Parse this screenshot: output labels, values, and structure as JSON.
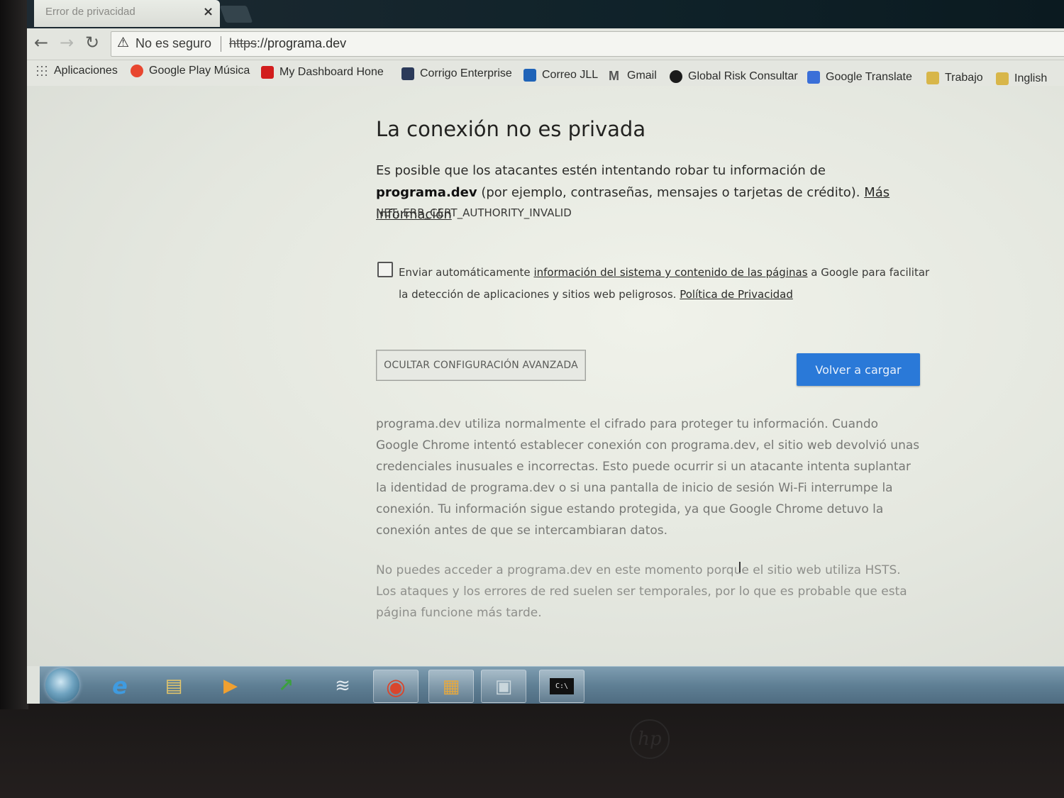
{
  "browser": {
    "tab_title": "Error de privacidad",
    "tab_close": "×",
    "security_label": "No es seguro",
    "url_scheme": "https",
    "url_rest": "://programa.dev"
  },
  "bookmarks": [
    {
      "label": "Aplicaciones",
      "icon": "apps-grid-icon",
      "color": "#6b6b6b"
    },
    {
      "label": "Google Play Música",
      "icon": "play-music-icon",
      "color": "#e8462f"
    },
    {
      "label": "My Dashboard Hone",
      "icon": "honeywell-icon",
      "color": "#d21d1d"
    },
    {
      "label": "Corrigo Enterprise",
      "icon": "corrigo-icon",
      "color": "#2b3a5a"
    },
    {
      "label": "Correo JLL",
      "icon": "outlook-icon",
      "color": "#1f63b8"
    },
    {
      "label": "Gmail",
      "icon": "gmail-icon",
      "color": "#555555"
    },
    {
      "label": "Global Risk Consultar",
      "icon": "global-risk-icon",
      "color": "#1b1b1b"
    },
    {
      "label": "Google Translate",
      "icon": "translate-icon",
      "color": "#3a6fd8"
    },
    {
      "label": "Trabajo",
      "icon": "folder-icon",
      "color": "#d8b64a"
    },
    {
      "label": "Inglish",
      "icon": "folder-icon",
      "color": "#d8b64a"
    }
  ],
  "page": {
    "heading": "La conexión no es privada",
    "intro_before": "Es posible que los atacantes estén intentando robar tu información de ",
    "intro_domain": "programa.dev",
    "intro_after": " (por ejemplo, contraseñas, mensajes o tarjetas de crédito). ",
    "more_info_link": "Más información",
    "error_code": "NET::ERR_CERT_AUTHORITY_INVALID",
    "checkbox_before": "Enviar automáticamente ",
    "checkbox_link": "información del sistema y contenido de las páginas",
    "checkbox_after": " a Google para facilitar la detección de aplicaciones y sitios web peligrosos. ",
    "privacy_link": "Política de Privacidad",
    "advanced_button": "OCULTAR CONFIGURACIÓN AVANZADA",
    "reload_button": "Volver a cargar",
    "details_paragraph": "programa.dev utiliza normalmente el cifrado para proteger tu información. Cuando Google Chrome intentó establecer conexión con programa.dev, el sitio web devolvió unas credenciales inusuales e incorrectas. Esto puede ocurrir si un atacante intenta suplantar la identidad de programa.dev o si una pantalla de inicio de sesión Wi-Fi interrumpe la conexión. Tu información sigue estando protegida, ya que Google Chrome detuvo la conexión antes de que se intercambiaran datos.",
    "hsts_paragraph": "No puedes acceder a programa.dev en este momento porque el sitio web utiliza HSTS. Los ataques y los errores de red suelen ser temporales, por lo que es probable que esta página funcione más tarde."
  },
  "taskbar": {
    "items": [
      {
        "icon": "internet-explorer-icon",
        "glyph": "e",
        "color": "#3f9be0"
      },
      {
        "icon": "file-explorer-icon",
        "glyph": "▤",
        "color": "#e6c76a"
      },
      {
        "icon": "media-player-icon",
        "glyph": "▶",
        "color": "#f0a030"
      },
      {
        "icon": "stock-chart-icon",
        "glyph": "↗",
        "color": "#3ca040"
      },
      {
        "icon": "wireless-icon",
        "glyph": "≋",
        "color": "#e0e8ee"
      },
      {
        "icon": "chrome-icon",
        "glyph": "◉",
        "color": "#d9462d"
      },
      {
        "icon": "app-tile-icon",
        "glyph": "▦",
        "color": "#e4a840"
      },
      {
        "icon": "notes-icon",
        "glyph": "▣",
        "color": "#c9d6dc"
      },
      {
        "icon": "command-prompt-icon",
        "glyph": "C:\\",
        "color": "#e9e9e9"
      }
    ]
  },
  "brand": "hp"
}
